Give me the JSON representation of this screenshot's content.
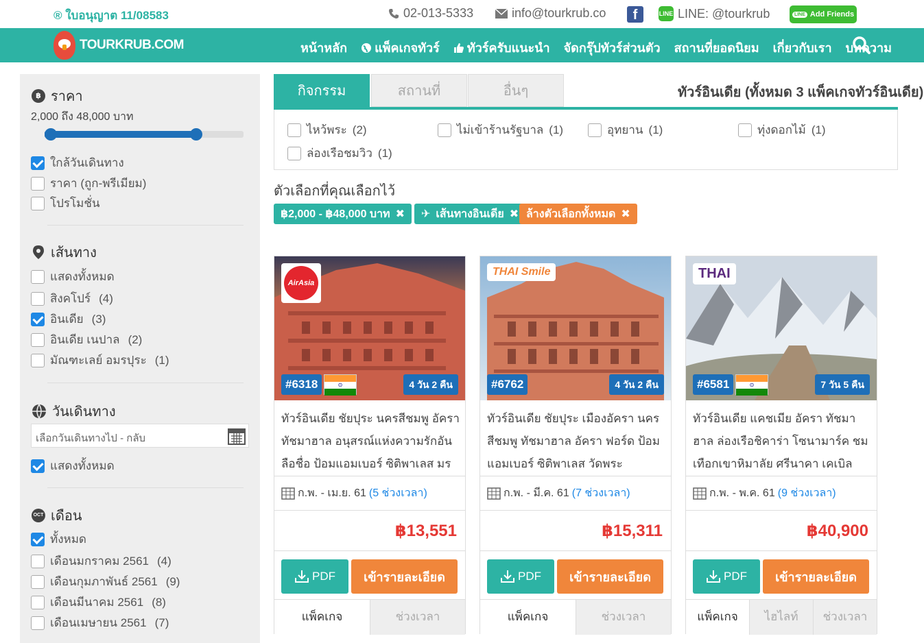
{
  "topbar": {
    "license": "® ใบอนุญาต 11/08583",
    "phone": "02-013-5333",
    "email": "info@tourkrub.co",
    "line": "LINE: @tourkrub",
    "line_icon_text": "LINE",
    "add_friends": "Add Friends"
  },
  "nav": {
    "logo": "TOURKRUB.COM",
    "items": [
      "หน้าหลัก",
      "แพ็คเกจทัวร์",
      "ทัวร์ครับแนะนำ",
      "จัดกรุ๊ปทัวร์ส่วนตัว",
      "สถานที่ยอดนิยม",
      "เกี่ยวกับเรา",
      "บทความ"
    ]
  },
  "sidebar": {
    "price": {
      "title": "ราคา",
      "icon_text": "฿",
      "range": "2,000 ถึง 48,000 บาท",
      "slider_low_fraction": 0.0,
      "slider_high_fraction": 0.78,
      "options": [
        {
          "label": "ใกล้วันเดินทาง",
          "checked": true
        },
        {
          "label": "ราคา (ถูก-พรีเมียม)",
          "checked": false
        },
        {
          "label": "โปรโมชั่น",
          "checked": false
        }
      ]
    },
    "route": {
      "title": "เส้นทาง",
      "options": [
        {
          "label": "แสดงทั้งหมด",
          "count": "",
          "checked": false
        },
        {
          "label": "สิงคโปร์",
          "count": "(4)",
          "checked": false
        },
        {
          "label": "อินเดีย",
          "count": "(3)",
          "checked": true
        },
        {
          "label": "อินเดีย เนปาล",
          "count": "(2)",
          "checked": false
        },
        {
          "label": "มัณฑะเลย์ อมรปุระ",
          "count": "(1)",
          "checked": false
        }
      ]
    },
    "date": {
      "title": "วันเดินทาง",
      "placeholder": "เลือกวันเดินทางไป - กลับ",
      "show_all": "แสดงทั้งหมด"
    },
    "month": {
      "title": "เดือน",
      "icon_text": "OCT",
      "options": [
        {
          "label": "ทั้งหมด",
          "count": "",
          "checked": true
        },
        {
          "label": "เดือนมกราคม 2561",
          "count": "(4)",
          "checked": false
        },
        {
          "label": "เดือนกุมภาพันธ์ 2561",
          "count": "(9)",
          "checked": false
        },
        {
          "label": "เดือนมีนาคม 2561",
          "count": "(8)",
          "checked": false
        },
        {
          "label": "เดือนเมษายน 2561",
          "count": "(7)",
          "checked": false
        }
      ]
    }
  },
  "main": {
    "tabs": [
      "กิจกรรม",
      "สถานที่",
      "อื่นๆ"
    ],
    "heading": "ทัวร์อินเดีย (ทั้งหมด 3 แพ็คเกจทัวร์อินเดีย)",
    "activities": [
      {
        "label": "ไหว้พระ",
        "count": "(2)"
      },
      {
        "label": "ไม่เข้าร้านรัฐบาล",
        "count": "(1)"
      },
      {
        "label": "อุทยาน",
        "count": "(1)"
      },
      {
        "label": "ทุ่งดอกไม้",
        "count": "(1)"
      },
      {
        "label": "ล่องเรือชมวิว",
        "count": "(1)"
      }
    ],
    "selected_title": "ตัวเลือกที่คุณเลือกไว้",
    "chips": [
      {
        "label": "฿2,000 - ฿48,000 บาท",
        "color": "#2db3a4"
      },
      {
        "label": "เส้นทางอินเดีย",
        "color": "#2db3a4"
      },
      {
        "label": "ล้างตัวเลือกทั้งหมด",
        "color": "#f0863b"
      }
    ]
  },
  "cards": [
    {
      "airline": "AirAsia",
      "code": "#6318",
      "days": "4 วัน 2 คืน",
      "title": "ทัวร์อินเดีย ชัยปุระ นครสีชมพู อัครา ทัชมาฮาล อนุสรณ์แห่งความรักอันลือชื่อ ป้อมแอมเบอร์ ซิติพาเลส มรดกโลกอั...",
      "date": "ก.พ. - เม.ย. 61",
      "rounds": "(5 ช่วงเวลา)",
      "price": "฿13,551",
      "pdf": "PDF",
      "detail": "เข้ารายละเอียด",
      "tabs": [
        "แพ็คเกจ",
        "ช่วงเวลา"
      ]
    },
    {
      "airline": "THAI Smile",
      "code": "#6762",
      "days": "4 วัน 2 คืน",
      "title": "ทัวร์อินเดีย ชัยปุระ เมืองอัครา นครสีชมพู ทัชมาฮาล อัครา ฟอร์ด ป้อมแอมเบอร์ ซิติพาเลส วัดพระพิฆเนศ...",
      "date": "ก.พ. - มี.ค. 61",
      "rounds": "(7 ช่วงเวลา)",
      "price": "฿15,311",
      "pdf": "PDF",
      "detail": "เข้ารายละเอียด",
      "tabs": [
        "แพ็คเกจ",
        "ช่วงเวลา"
      ]
    },
    {
      "airline": "THAI",
      "code": "#6581",
      "days": "7 วัน 5 คืน",
      "title": "ทัวร์อินเดีย แคชเมีย อัครา ทัชมาฮาล ล่องเรือชิคาร่า โซนามาร์ค ชมเทือกเขาหิมาลัย ศรีนาคา เคเบิลคาร์ (รวมค่า...",
      "date": "ก.พ. - พ.ค. 61",
      "rounds": "(9 ช่วงเวลา)",
      "price": "฿40,900",
      "pdf": "PDF",
      "detail": "เข้ารายละเอียด",
      "tabs": [
        "แพ็คเกจ",
        "ไฮไลท์",
        "ช่วงเวลา"
      ]
    }
  ],
  "colors": {
    "brand": "#2db3a4",
    "accent": "#f0863b",
    "price": "#e53935",
    "blue": "#1e6fb8"
  }
}
